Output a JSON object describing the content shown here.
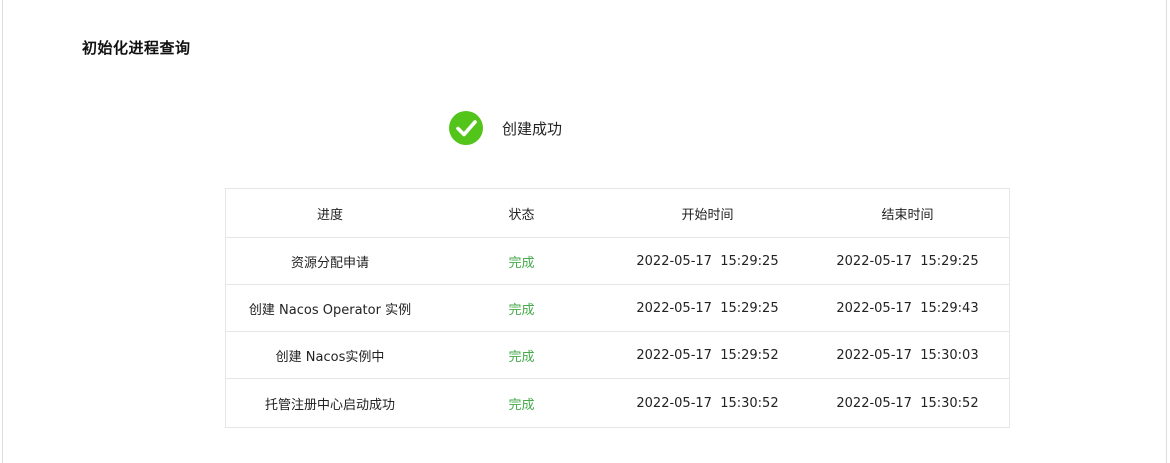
{
  "page": {
    "title": "初始化进程查询"
  },
  "status": {
    "icon": "check-circle-icon",
    "icon_color": "#52c41a",
    "text": "创建成功"
  },
  "table": {
    "headers": [
      "进度",
      "状态",
      "开始时间",
      "结束时间"
    ],
    "rows": [
      {
        "step": "资源分配申请",
        "state": "完成",
        "start": "2022-05-17  15:29:25",
        "end": "2022-05-17  15:29:25"
      },
      {
        "step": "创建 Nacos Operator 实例",
        "state": "完成",
        "start": "2022-05-17  15:29:25",
        "end": "2022-05-17  15:29:43"
      },
      {
        "step": "创建 Nacos实例中",
        "state": "完成",
        "start": "2022-05-17  15:29:52",
        "end": "2022-05-17  15:30:03"
      },
      {
        "step": "托管注册中心启动成功",
        "state": "完成",
        "start": "2022-05-17  15:30:52",
        "end": "2022-05-17  15:30:52"
      }
    ],
    "done_color": "#44aa4a"
  }
}
